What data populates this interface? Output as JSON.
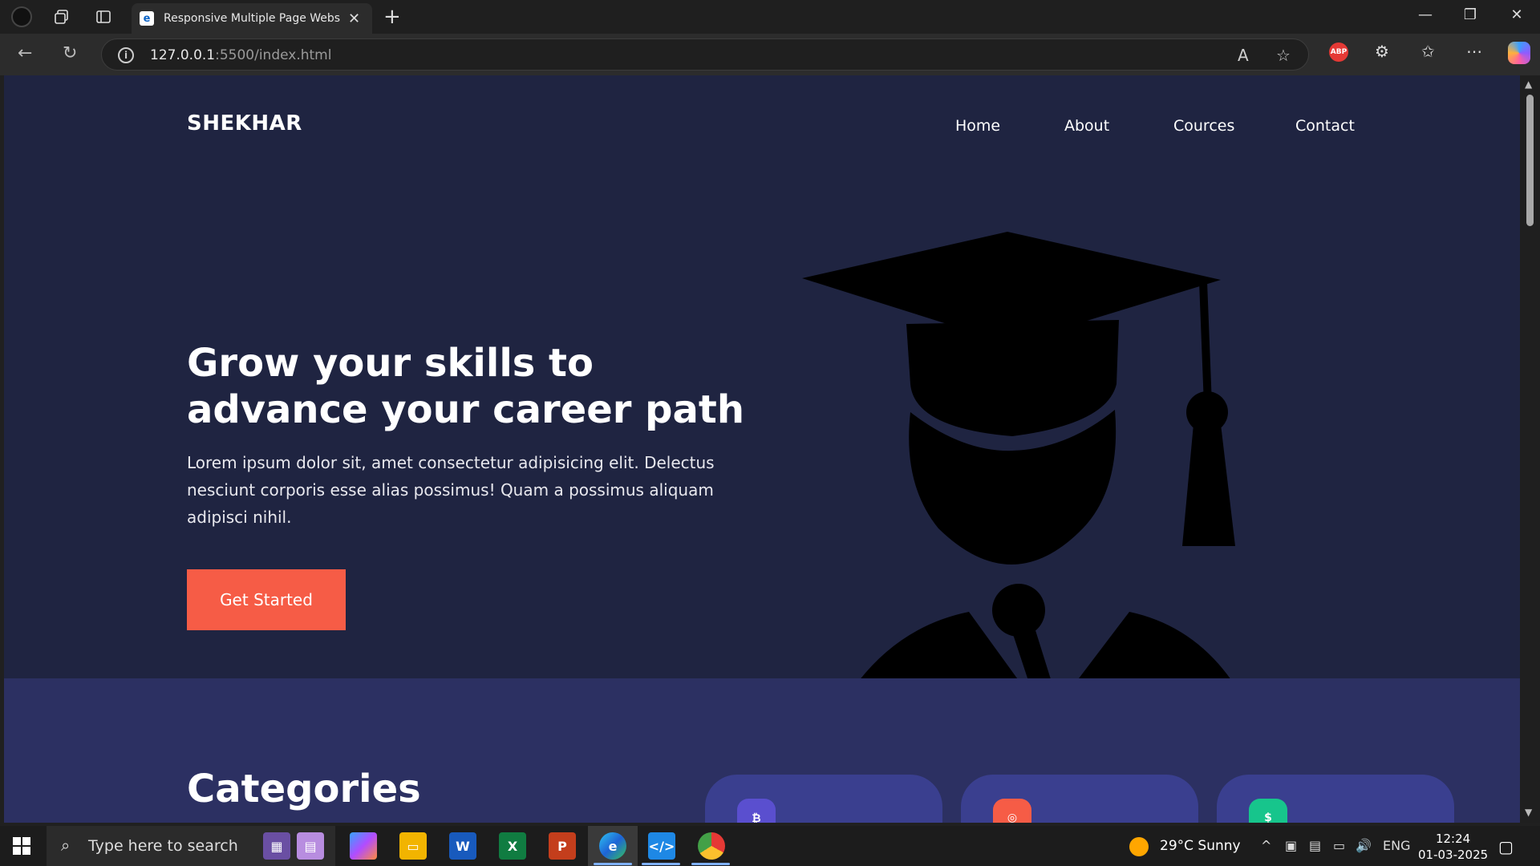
{
  "browser": {
    "tab_title": "Responsive Multiple Page Website",
    "url_host": "127.0.0.1",
    "url_rest": ":5500/index.html",
    "abp_label": "ABP"
  },
  "site": {
    "logo": "SHEKHAR",
    "nav": [
      "Home",
      "About",
      "Cources",
      "Contact"
    ],
    "hero_title": "Grow your skills to advance your career path",
    "hero_desc": "Lorem ipsum dolor sit, amet consectetur adipisicing elit. Delectus nesciunt corporis esse alias possimus! Quam a possimus aliquam adipisci nihil.",
    "cta": "Get Started",
    "categories_title": "Categories",
    "category_icon_colors": [
      "#5a4fcf",
      "#f65c46",
      "#17c58c"
    ]
  },
  "taskbar": {
    "search_placeholder": "Type here to search",
    "weather": "29°C  Sunny",
    "lang": "ENG",
    "time": "12:24",
    "date": "01-03-2025"
  },
  "colors": {
    "hero_bg": "#1f2441",
    "accent": "#f65c46",
    "categories_bg": "#2c3062"
  }
}
